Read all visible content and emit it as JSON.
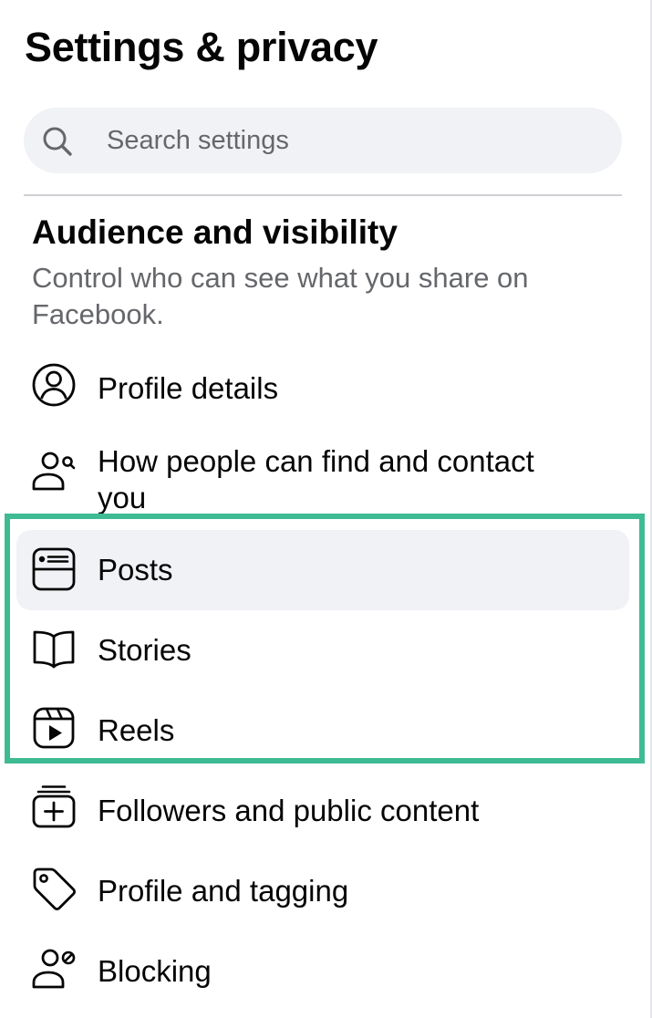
{
  "page": {
    "title": "Settings & privacy"
  },
  "search": {
    "placeholder": "Search settings",
    "icon": "search-icon"
  },
  "section": {
    "title": "Audience and visibility",
    "description": "Control who can see what you share on Facebook."
  },
  "menu": {
    "items": [
      {
        "label": "Profile details",
        "icon": "profile-circle-icon"
      },
      {
        "label": "How people can find and contact",
        "label_cont": "you",
        "icon": "find-contact-icon"
      },
      {
        "label": "Posts",
        "icon": "posts-icon",
        "selected": true
      },
      {
        "label": "Stories",
        "icon": "book-icon"
      },
      {
        "label": "Reels",
        "icon": "reels-icon"
      },
      {
        "label": "Followers and public content",
        "icon": "followers-icon"
      },
      {
        "label": "Profile and tagging",
        "icon": "tag-icon"
      },
      {
        "label": "Blocking",
        "icon": "blocking-icon"
      }
    ]
  },
  "colors": {
    "highlight": "#3fbb94",
    "selected_background": "#f0f2f5",
    "secondary_text": "#65676b"
  }
}
